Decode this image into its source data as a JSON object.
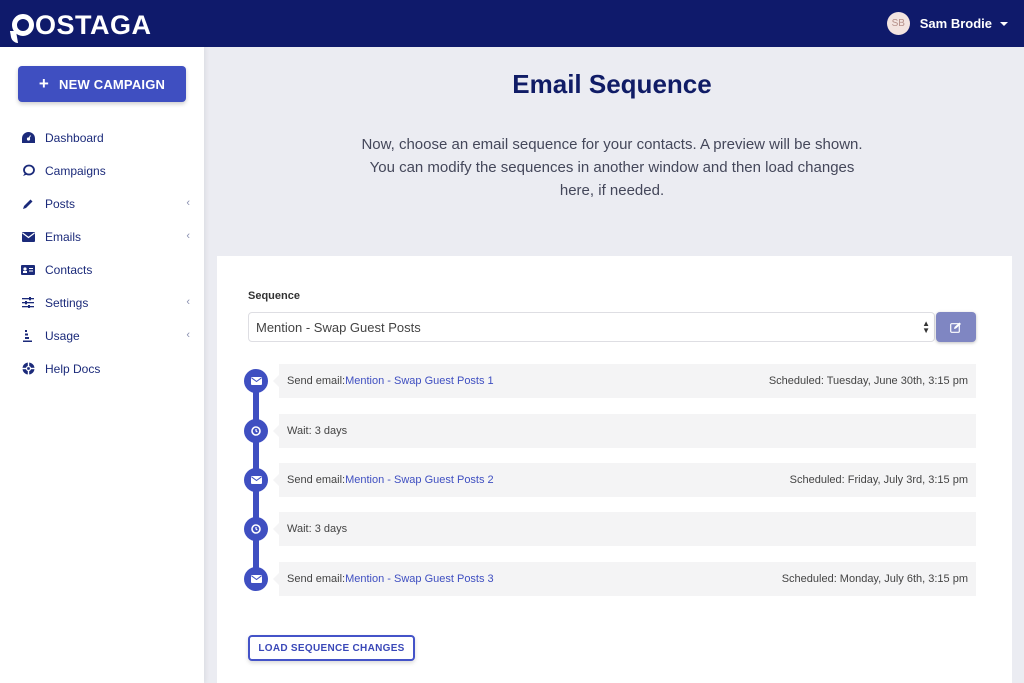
{
  "brand": {
    "name": "OSTAGA",
    "full_name": "POSTAGA"
  },
  "user": {
    "initials": "SB",
    "name": "Sam Brodie"
  },
  "sidebar": {
    "new_campaign_label": "NEW CAMPAIGN",
    "items": [
      {
        "label": "Dashboard",
        "icon": "dashboard-icon",
        "has_submenu": false
      },
      {
        "label": "Campaigns",
        "icon": "campaigns-icon",
        "has_submenu": false
      },
      {
        "label": "Posts",
        "icon": "pencil-icon",
        "has_submenu": true
      },
      {
        "label": "Emails",
        "icon": "envelope-icon",
        "has_submenu": true
      },
      {
        "label": "Contacts",
        "icon": "address-card-icon",
        "has_submenu": false
      },
      {
        "label": "Settings",
        "icon": "sliders-icon",
        "has_submenu": true
      },
      {
        "label": "Usage",
        "icon": "usage-icon",
        "has_submenu": true
      },
      {
        "label": "Help Docs",
        "icon": "life-ring-icon",
        "has_submenu": false
      }
    ]
  },
  "main": {
    "title": "Email Sequence",
    "intro": "Now, choose an email sequence for your contacts. A preview will be shown. You can modify the sequences in another window and then load changes here, if needed.",
    "sequence_label": "Sequence",
    "sequence_value": "Mention - Swap Guest Posts",
    "steps": [
      {
        "type": "email",
        "prefix": "Send email:",
        "link": "Mention - Swap Guest Posts 1",
        "scheduled": "Scheduled: Tuesday, June 30th, 3:15 pm"
      },
      {
        "type": "wait",
        "prefix": "Wait: 3 days",
        "link": "",
        "scheduled": ""
      },
      {
        "type": "email",
        "prefix": "Send email:",
        "link": "Mention - Swap Guest Posts 2",
        "scheduled": "Scheduled: Friday, July 3rd, 3:15 pm"
      },
      {
        "type": "wait",
        "prefix": "Wait: 3 days",
        "link": "",
        "scheduled": ""
      },
      {
        "type": "email",
        "prefix": "Send email:",
        "link": "Mention - Swap Guest Posts 3",
        "scheduled": "Scheduled: Monday, July 6th, 3:15 pm"
      }
    ],
    "load_button_label": "LOAD SEQUENCE CHANGES"
  },
  "colors": {
    "header": "#0f1a6b",
    "accent": "#3f4fc1",
    "edit_button": "#7f86c2"
  }
}
